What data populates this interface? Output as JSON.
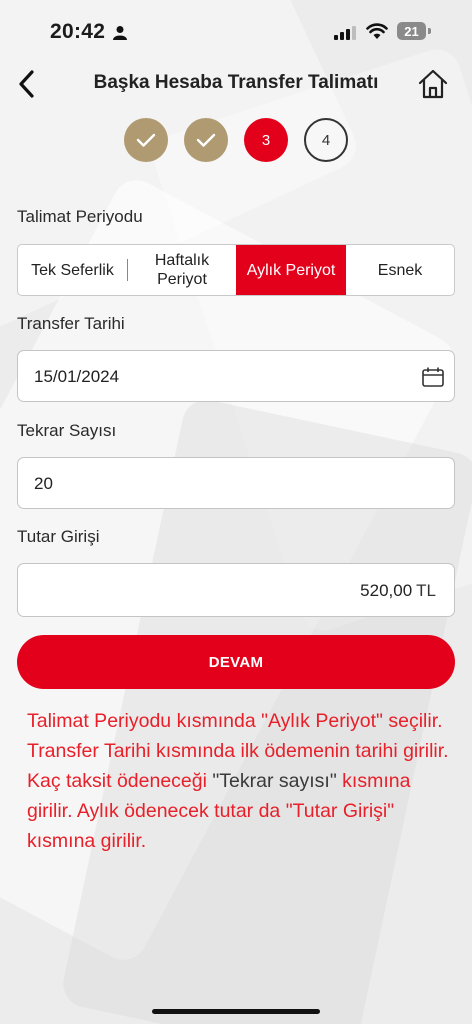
{
  "status_bar": {
    "time": "20:42",
    "battery": "21"
  },
  "header": {
    "title": "Başka Hesaba Transfer Talimatı"
  },
  "steps": [
    {
      "state": "done",
      "label": ""
    },
    {
      "state": "done",
      "label": ""
    },
    {
      "state": "active",
      "label": "3"
    },
    {
      "state": "todo",
      "label": "4"
    }
  ],
  "period": {
    "label": "Talimat Periyodu",
    "options": [
      "Tek Seferlik",
      "Haftalık Periyot",
      "Aylık Periyot",
      "Esnek"
    ],
    "selected": "Aylık Periyot"
  },
  "transfer_date": {
    "label": "Transfer Tarihi",
    "value": "15/01/2024"
  },
  "repeat_count": {
    "label": "Tekrar Sayısı",
    "value": "20"
  },
  "amount": {
    "label": "Tutar Girişi",
    "value": "520,00",
    "currency": "TL"
  },
  "continue_button": {
    "label": "DEVAM"
  },
  "instruction": {
    "part1": "Talimat Periyodu kısmında \"Aylık Periyot\" seçilir. Transfer Tarihi kısmında ilk ödemenin tarihi girilir. Kaç taksit ödeneceği ",
    "part2": "\"Tekrar sayısı\"",
    "part3": " kısmına girilir. Aylık ödenecek tutar da \"Tutar Girişi\" kısmına girilir."
  },
  "colors": {
    "accent": "#e3001b",
    "done_step": "#b09a72",
    "note": "#e8202a"
  }
}
